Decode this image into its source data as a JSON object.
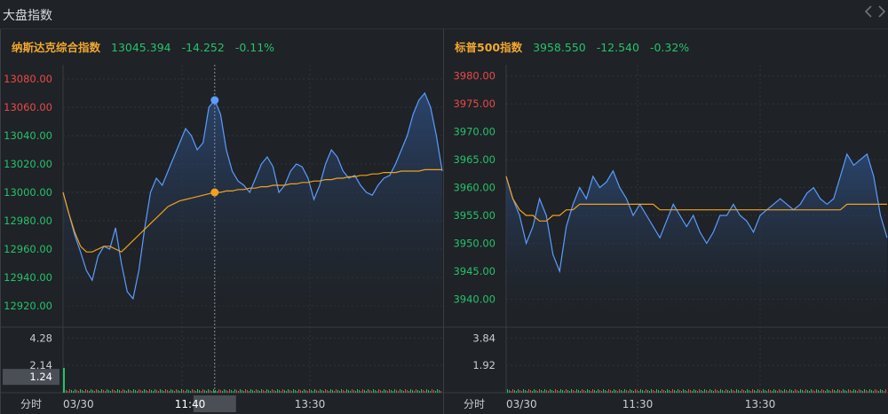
{
  "header": {
    "title": "大盘指数",
    "prev_icon": "chevron-left-icon",
    "next_icon": "chevron-right-icon"
  },
  "colors": {
    "up": "#e84a4a",
    "down": "#26c26c",
    "price_line": "#5b9cff",
    "avg_line": "#f0a21e",
    "name": "#f0a830"
  },
  "left": {
    "name": "纳斯达克综合指数",
    "price": "13045.394",
    "change": "-14.252",
    "change_pct": "-0.11%",
    "price_ticks": [
      {
        "label": "13080.00",
        "value": 13080,
        "color": "up"
      },
      {
        "label": "13060.00",
        "value": 13060,
        "color": "up"
      },
      {
        "label": "13040.00",
        "value": 13040,
        "color": "down"
      },
      {
        "label": "13020.00",
        "value": 13020,
        "color": "down"
      },
      {
        "label": "13000.00",
        "value": 13000,
        "color": "down"
      },
      {
        "label": "12980.00",
        "value": 12980,
        "color": "down"
      },
      {
        "label": "12960.00",
        "value": 12960,
        "color": "down"
      },
      {
        "label": "12940.00",
        "value": 12940,
        "color": "down"
      },
      {
        "label": "12920.00",
        "value": 12920,
        "color": "down"
      }
    ],
    "volume_ticks": [
      {
        "label": "4.28",
        "value": 4.28
      },
      {
        "label": "2.14",
        "value": 2.14
      }
    ],
    "crosshair_volume": "1.24",
    "crosshair_time": "11:40",
    "time_label": "分时",
    "time_ticks": [
      "03/30",
      "11:40",
      "13:30"
    ]
  },
  "right": {
    "name": "标普500指数",
    "price": "3958.550",
    "change": "-12.540",
    "change_pct": "-0.32%",
    "price_ticks": [
      {
        "label": "3980.00",
        "value": 3980,
        "color": "up"
      },
      {
        "label": "3975.00",
        "value": 3975,
        "color": "up"
      },
      {
        "label": "3970.00",
        "value": 3970,
        "color": "down"
      },
      {
        "label": "3965.00",
        "value": 3965,
        "color": "down"
      },
      {
        "label": "3960.00",
        "value": 3960,
        "color": "down"
      },
      {
        "label": "3955.00",
        "value": 3955,
        "color": "down"
      },
      {
        "label": "3950.00",
        "value": 3950,
        "color": "down"
      },
      {
        "label": "3945.00",
        "value": 3945,
        "color": "down"
      },
      {
        "label": "3940.00",
        "value": 3940,
        "color": "down"
      }
    ],
    "volume_ticks": [
      {
        "label": "3.84",
        "value": 3.84
      },
      {
        "label": "1.92",
        "value": 1.92
      }
    ],
    "time_label": "分时",
    "time_ticks": [
      "03/30",
      "11:30",
      "13:30"
    ]
  },
  "chart_data": [
    {
      "type": "line",
      "title": "纳斯达克综合指数",
      "ylim": [
        12905,
        13090
      ],
      "series": [
        {
          "values": [
            13000,
            12985,
            12970,
            12958,
            12945,
            12938,
            12955,
            12962,
            12960,
            12975,
            12950,
            12930,
            12925,
            12945,
            12975,
            13000,
            13010,
            13005,
            13015,
            13025,
            13035,
            13045,
            13040,
            13030,
            13035,
            13060,
            13065,
            13055,
            13030,
            13015,
            13008,
            13005,
            13000,
            13010,
            13020,
            13025,
            13018,
            13000,
            13005,
            13015,
            13020,
            13018,
            13010,
            12995,
            13005,
            13020,
            13030,
            13025,
            13015,
            13010,
            13012,
            13005,
            13000,
            12998,
            13005,
            13010,
            13012,
            13020,
            13030,
            13040,
            13055,
            13065,
            13070,
            13060,
            13040,
            13015
          ]
        },
        {
          "values": [
            13000,
            12985,
            12972,
            12962,
            12958,
            12958,
            12960,
            12962,
            12962,
            12960,
            12958,
            12962,
            12966,
            12970,
            12974,
            12978,
            12982,
            12986,
            12990,
            12992,
            12994,
            12995,
            12996,
            12997,
            12998,
            12999,
            13000,
            13000,
            13001,
            13001,
            13002,
            13002,
            13003,
            13003,
            13004,
            13004,
            13005,
            13005,
            13005,
            13006,
            13006,
            13007,
            13007,
            13008,
            13008,
            13009,
            13009,
            13010,
            13010,
            13011,
            13011,
            13012,
            13012,
            13013,
            13013,
            13014,
            13014,
            13014,
            13015,
            13015,
            13015,
            13015,
            13016,
            13016,
            13016,
            13016
          ]
        }
      ]
    },
    {
      "type": "line",
      "title": "标普500指数",
      "ylim": [
        3935,
        3982
      ],
      "series": [
        {
          "values": [
            3962,
            3958,
            3955,
            3950,
            3953,
            3958,
            3955,
            3948,
            3945,
            3953,
            3957,
            3960,
            3958,
            3962,
            3960,
            3961,
            3963,
            3960,
            3958,
            3955,
            3957,
            3955,
            3953,
            3951,
            3954,
            3957,
            3955,
            3953,
            3955,
            3952,
            3950,
            3952,
            3955,
            3955,
            3957,
            3955,
            3954,
            3952,
            3955,
            3956,
            3957,
            3958,
            3957,
            3956,
            3957,
            3959,
            3960,
            3958,
            3957,
            3958,
            3962,
            3966,
            3964,
            3965,
            3966,
            3962,
            3955,
            3951
          ]
        },
        {
          "values": [
            3962,
            3958,
            3956,
            3955,
            3955,
            3954,
            3954,
            3955,
            3955,
            3956,
            3956,
            3957,
            3957,
            3957,
            3957,
            3957,
            3957,
            3957,
            3957,
            3957,
            3957,
            3957,
            3957,
            3956,
            3956,
            3956,
            3956,
            3956,
            3956,
            3956,
            3956,
            3956,
            3956,
            3956,
            3956,
            3956,
            3956,
            3956,
            3956,
            3956,
            3956,
            3956,
            3956,
            3956,
            3956,
            3956,
            3956,
            3956,
            3956,
            3956,
            3956,
            3957,
            3957,
            3957,
            3957,
            3957,
            3957,
            3957
          ]
        }
      ]
    }
  ]
}
